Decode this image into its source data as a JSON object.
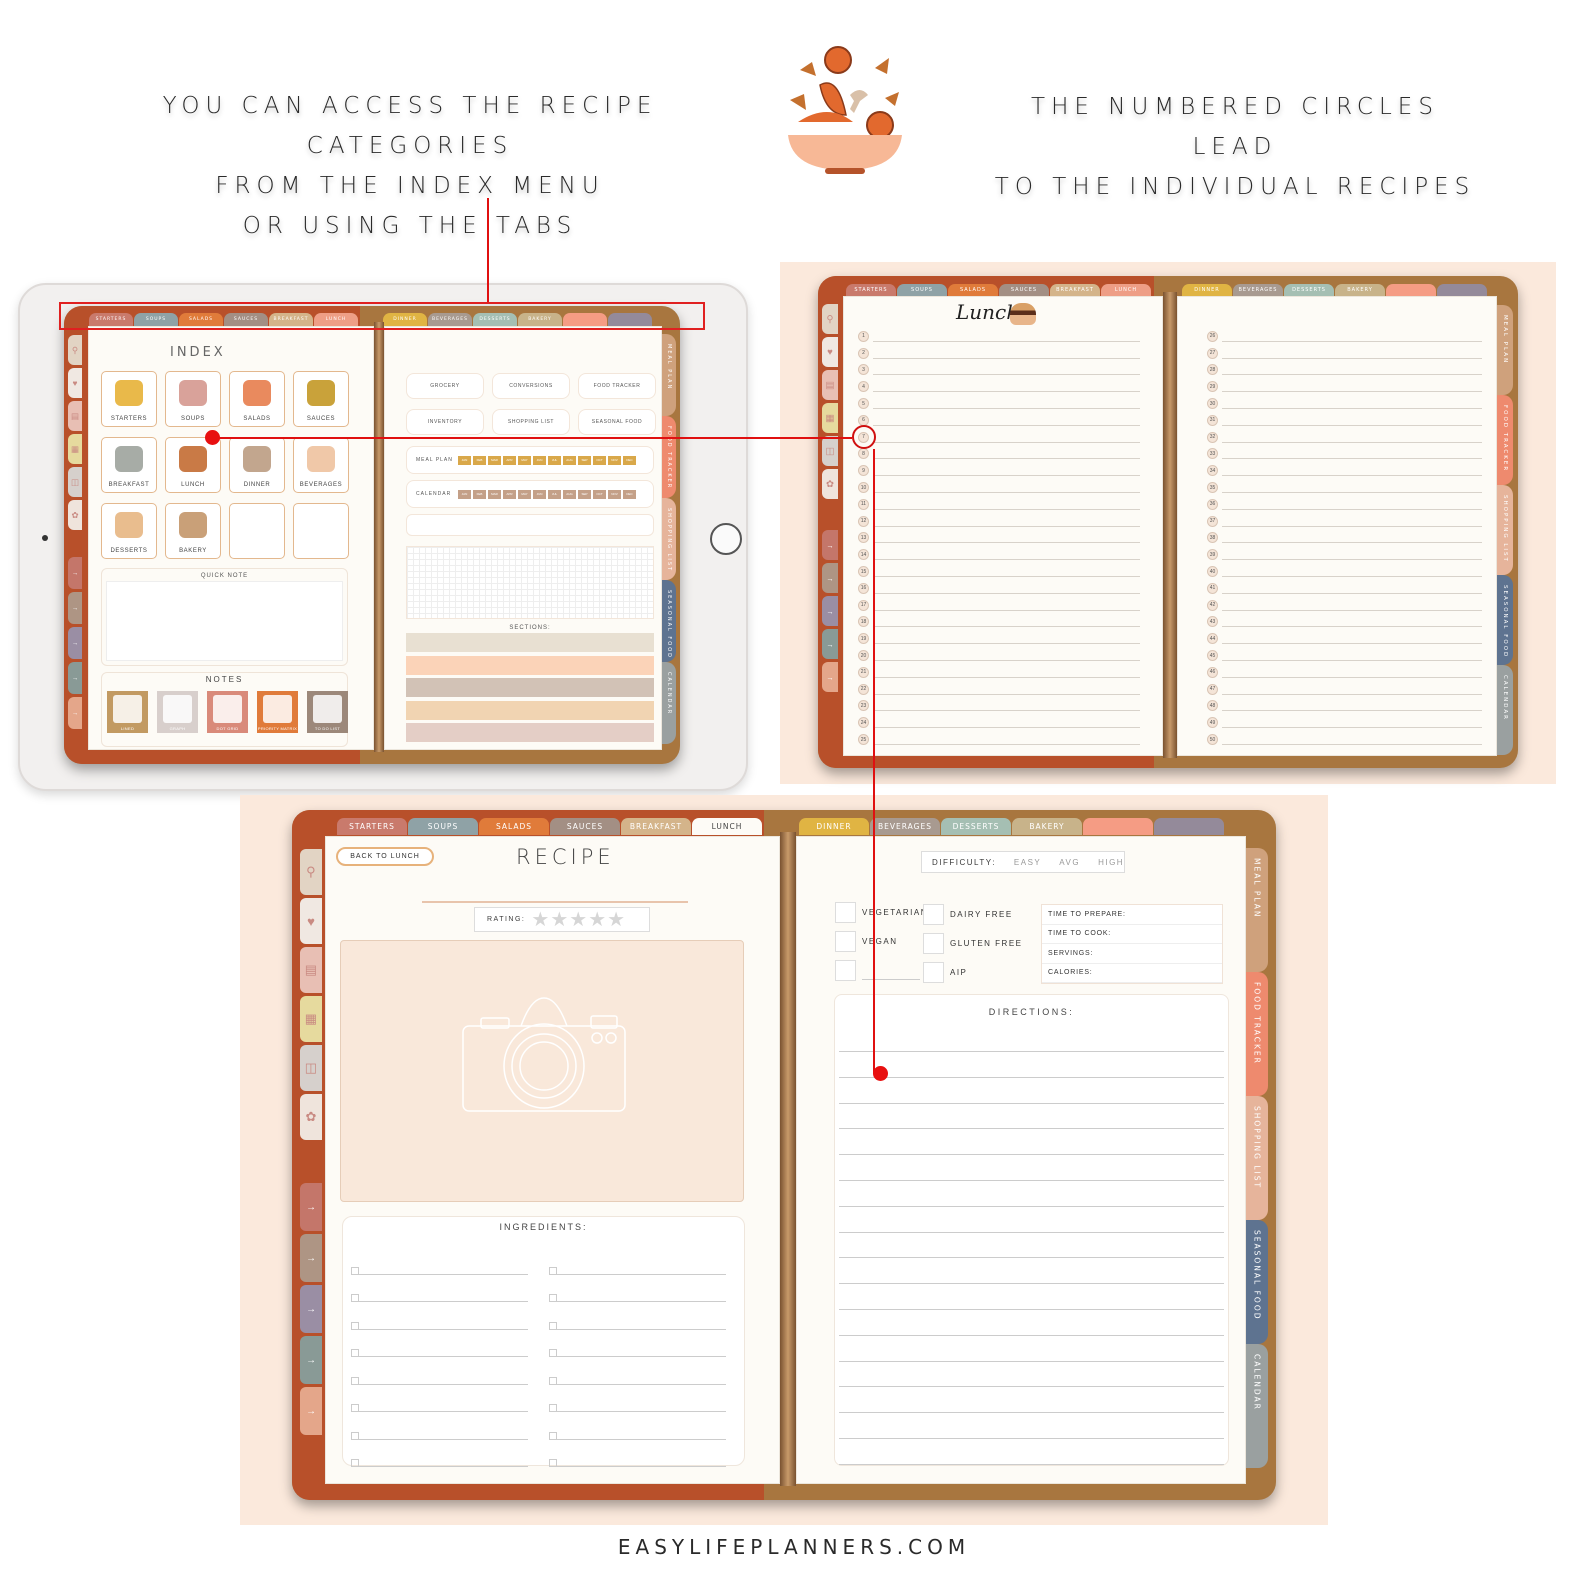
{
  "captions": {
    "left": [
      "YOU CAN ACCESS THE RECIPE CATEGORIES",
      "FROM  THE INDEX MENU",
      "OR USING THE TABS"
    ],
    "right": [
      "THE NUMBERED CIRCLES LEAD",
      "TO THE INDIVIDUAL RECIPES"
    ],
    "footer": "EASYLIFEPLANNERS.COM"
  },
  "tabs": [
    {
      "label": "STARTERS",
      "color": "#c97a6c"
    },
    {
      "label": "SOUPS",
      "color": "#8fa2a6"
    },
    {
      "label": "SALADS",
      "color": "#e07b3a"
    },
    {
      "label": "SAUCES",
      "color": "#a38f84"
    },
    {
      "label": "BREAKFAST",
      "color": "#d4b48a"
    },
    {
      "label": "LUNCH",
      "color": "#ee9e86"
    },
    {
      "label": "DINNER",
      "color": "#e0b443"
    },
    {
      "label": "BEVERAGES",
      "color": "#a89a90"
    },
    {
      "label": "DESSERTS",
      "color": "#a5bfb3"
    },
    {
      "label": "BAKERY",
      "color": "#c8b38a"
    },
    {
      "label": "",
      "color": "#f59c84"
    },
    {
      "label": "",
      "color": "#948a9a"
    }
  ],
  "side_tabs": [
    {
      "label": "MEAL PLAN",
      "color": "#cfa17c"
    },
    {
      "label": "FOOD TRACKER",
      "color": "#ee8a6e"
    },
    {
      "label": "SHOPPING LIST",
      "color": "#e6b49b"
    },
    {
      "label": "SEASONAL FOOD",
      "color": "#5e7390"
    },
    {
      "label": "CALENDAR",
      "color": "#9aa0a0"
    }
  ],
  "left_tabs": {
    "icons": [
      {
        "icon": "search-icon",
        "color": "#e2d4c4",
        "glyph": "⚲"
      },
      {
        "icon": "heart-icon",
        "color": "#f0e8e2",
        "glyph": "♥"
      },
      {
        "icon": "notebook-icon",
        "color": "#e8bfb4",
        "glyph": "▤"
      },
      {
        "icon": "planner-icon",
        "color": "#e6da9e",
        "glyph": "▦"
      },
      {
        "icon": "cup-icon",
        "color": "#d6d0cc",
        "glyph": "◫"
      },
      {
        "icon": "bag-icon",
        "color": "#efe4dc",
        "glyph": "✿"
      }
    ],
    "arrows": [
      {
        "color": "#c4766a",
        "glyph": "→"
      },
      {
        "color": "#ae9584",
        "glyph": "→"
      },
      {
        "color": "#9a8ea4",
        "glyph": "→"
      },
      {
        "color": "#899a96",
        "glyph": "→"
      },
      {
        "color": "#e4a68a",
        "glyph": "→"
      }
    ]
  },
  "index_page": {
    "title": "INDEX",
    "categories": [
      {
        "label": "STARTERS",
        "color": "#e9b94a"
      },
      {
        "label": "SOUPS",
        "color": "#d9a29a"
      },
      {
        "label": "SALADS",
        "color": "#e98a5e"
      },
      {
        "label": "SAUCES",
        "color": "#c9a23a"
      },
      {
        "label": "BREAKFAST",
        "color": "#a7aca6"
      },
      {
        "label": "LUNCH",
        "color": "#c97a46"
      },
      {
        "label": "DINNER",
        "color": "#c2a68e"
      },
      {
        "label": "BEVERAGES",
        "color": "#f0c8a8"
      },
      {
        "label": "DESSERTS",
        "color": "#e9bd8e"
      },
      {
        "label": "BAKERY",
        "color": "#c9a078"
      },
      {
        "label": "",
        "color": ""
      },
      {
        "label": "",
        "color": ""
      }
    ],
    "quick_note": "QUICK NOTE",
    "notes_title": "NOTES",
    "notes": [
      {
        "label": "LINED",
        "color": "#c29a62"
      },
      {
        "label": "GRAPH",
        "color": "#d8cfcc"
      },
      {
        "label": "DOT GRID",
        "color": "#d98a7a"
      },
      {
        "label": "PRIORITY MATRIX",
        "color": "#e07b3a"
      },
      {
        "label": "TO DO LIST",
        "color": "#9c887a"
      }
    ],
    "links": [
      "GROCERY",
      "CONVERSIONS",
      "FOOD TRACKER",
      "INVENTORY",
      "SHOPPING LIST",
      "SEASONAL FOOD"
    ],
    "meal_plan": {
      "label": "MEAL PLAN",
      "color": "#d9a84a"
    },
    "calendar": {
      "label": "CALENDAR",
      "color": "#c4a088"
    },
    "months": [
      "JAN",
      "FEB",
      "MAR",
      "APR",
      "MAY",
      "JUN",
      "JUL",
      "AUG",
      "SEP",
      "OCT",
      "NOV",
      "DEC"
    ],
    "sections_title": "SECTIONS:",
    "sections": [
      "#e8e0d2",
      "#fbd3b8",
      "#d2c2b6",
      "#f1d4b2",
      "#e4cec6"
    ],
    "footer": "EASYLIFEPLANNERS.COM"
  },
  "lunch_page": {
    "title": "Lunch",
    "numbers_left": [
      1,
      2,
      3,
      4,
      5,
      6,
      7,
      8,
      9,
      10,
      11,
      12,
      13,
      14,
      15,
      16,
      17,
      18,
      19,
      20,
      21,
      22,
      23,
      24,
      25
    ],
    "numbers_right": [
      26,
      27,
      28,
      29,
      30,
      31,
      32,
      33,
      34,
      35,
      36,
      37,
      38,
      39,
      40,
      41,
      42,
      43,
      44,
      45,
      46,
      47,
      48,
      49,
      50
    ],
    "footer": "EASYLIFEPLANNERS.COM"
  },
  "recipe_page": {
    "back_label": "BACK TO LUNCH",
    "title": "RECIPE",
    "rating_label": "RATING:",
    "rating_value": 0,
    "rating_max": 5,
    "difficulty_label": "DIFFICULTY:",
    "difficulty_options": [
      "EASY",
      "AVG",
      "HIGH"
    ],
    "diet_checks": [
      "VEGETARIAN",
      "VEGAN",
      "",
      "DAIRY FREE",
      "GLUTEN FREE",
      "AIP"
    ],
    "info_fields": [
      "TIME TO PREPARE:",
      "TIME TO COOK:",
      "SERVINGS:",
      "CALORIES:"
    ],
    "ingredients_title": "INGREDIENTS:",
    "ingredient_rows": 8,
    "directions_title": "DIRECTIONS:",
    "direction_lines": 17
  }
}
